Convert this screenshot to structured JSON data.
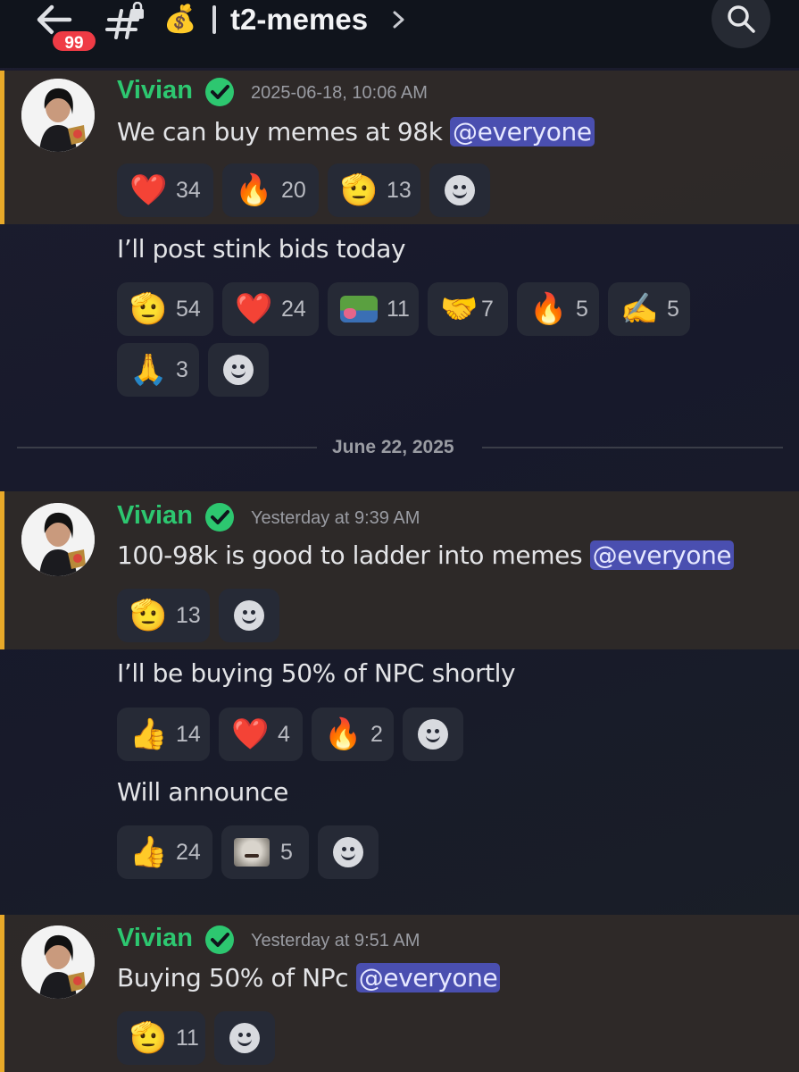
{
  "header": {
    "unread_count": "99",
    "channel_emoji": "💰",
    "channel_name": "t2-memes"
  },
  "divider_date": "June 22, 2025",
  "messages": [
    {
      "author": "Vivian",
      "timestamp": "2025-06-18, 10:06 AM",
      "lines": [
        {
          "text": "We can buy memes at 98k ",
          "mention": "@everyone",
          "reactions": [
            {
              "emoji": "❤️",
              "count": "34"
            },
            {
              "emoji": "🔥",
              "count": "20"
            },
            {
              "emoji": "🫡",
              "count": "13"
            }
          ]
        },
        {
          "text": "I’ll post stink bids today",
          "reactions": [
            {
              "emoji": "🫡",
              "count": "54"
            },
            {
              "emoji": "❤️",
              "count": "24"
            },
            {
              "emoji": "pepe-custom-emoji",
              "count": "11"
            },
            {
              "emoji": "🤝",
              "count": "7"
            },
            {
              "emoji": "🔥",
              "count": "5"
            },
            {
              "emoji": "✍️",
              "count": "5"
            },
            {
              "emoji": "🙏",
              "count": "3"
            }
          ]
        }
      ]
    },
    {
      "author": "Vivian",
      "timestamp": "Yesterday at 9:39 AM",
      "lines": [
        {
          "text": "100-98k is good to ladder into memes ",
          "mention": "@everyone",
          "reactions": [
            {
              "emoji": "🫡",
              "count": "13"
            }
          ]
        },
        {
          "text": "I’ll be buying 50% of NPC shortly",
          "reactions": [
            {
              "emoji": "👍",
              "count": "14"
            },
            {
              "emoji": "❤️",
              "count": "4"
            },
            {
              "emoji": "🔥",
              "count": "2"
            }
          ]
        },
        {
          "text": "Will announce",
          "reactions": [
            {
              "emoji": "👍",
              "count": "24"
            },
            {
              "emoji": "cat-custom-emoji",
              "count": "5"
            }
          ]
        }
      ]
    },
    {
      "author": "Vivian",
      "timestamp": "Yesterday at 9:51 AM",
      "lines": [
        {
          "text": "Buying 50% of NPc ",
          "mention": "@everyone",
          "reactions": [
            {
              "emoji": "🫡",
              "count": "11"
            }
          ]
        }
      ]
    }
  ],
  "colors": {
    "username": "#2dc770",
    "highlight_bar": "#e8a929",
    "mention_bg": "#4a4fb0",
    "unread_badge": "#ef3b45",
    "verified_badge": "#2dc770"
  }
}
